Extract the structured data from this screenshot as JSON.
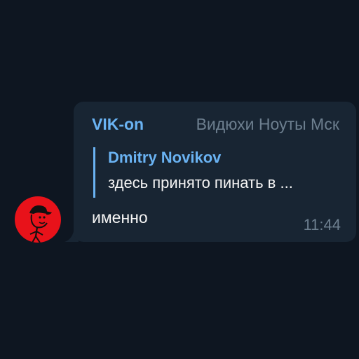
{
  "message": {
    "sender": {
      "name": "VIK-on",
      "title": "Видюхи Ноуты Мск",
      "avatar_color": "#e8121a"
    },
    "reply": {
      "author": "Dmitry Novikov",
      "text": "здесь принято пинать в ..."
    },
    "text": "именно",
    "time": "11:44"
  },
  "colors": {
    "background": "#0e1621",
    "bubble": "#182533",
    "accent": "#6ab3f3",
    "muted": "#6d7f8f",
    "text": "#f5f5f5"
  }
}
